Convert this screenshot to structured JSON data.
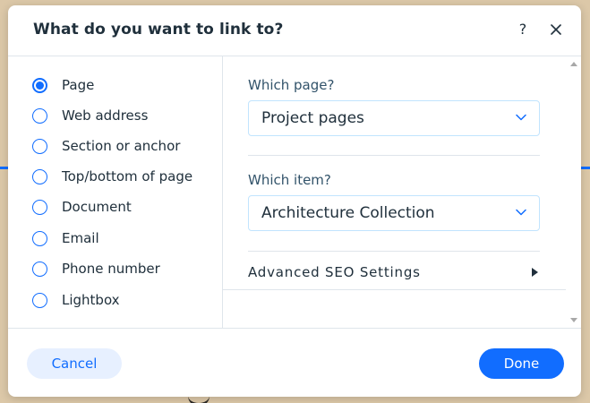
{
  "dialog": {
    "title": "What do you want to link to?",
    "help_label": "?"
  },
  "link_types": [
    {
      "label": "Page",
      "selected": true
    },
    {
      "label": "Web address",
      "selected": false
    },
    {
      "label": "Section or anchor",
      "selected": false
    },
    {
      "label": "Top/bottom of page",
      "selected": false
    },
    {
      "label": "Document",
      "selected": false
    },
    {
      "label": "Email",
      "selected": false
    },
    {
      "label": "Phone number",
      "selected": false
    },
    {
      "label": "Lightbox",
      "selected": false
    }
  ],
  "page_select": {
    "label": "Which page?",
    "value": "Project pages"
  },
  "item_select": {
    "label": "Which item?",
    "value": "Architecture Collection"
  },
  "advanced": {
    "label": "Advanced SEO Settings"
  },
  "footer": {
    "cancel_label": "Cancel",
    "done_label": "Done"
  },
  "colors": {
    "accent": "#116dff",
    "text": "#20303c",
    "secondary_text": "#32536a",
    "cancel_bg": "#e7f0ff",
    "divider": "#dfe5eb"
  },
  "icons": {
    "close": "close-icon",
    "help": "help-icon",
    "chevron": "chevron-down-icon",
    "arrow": "arrow-right-icon"
  }
}
